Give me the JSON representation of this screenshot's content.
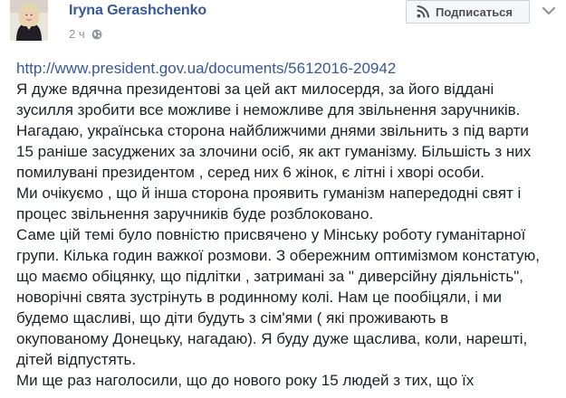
{
  "post": {
    "author": "Iryna Gerashchenko",
    "time": "2 ч",
    "privacy_icon": "globe-icon",
    "subscribe": {
      "label": "Подписаться",
      "icon": "rss-icon"
    },
    "options_icon": "chevron-down-icon",
    "link": "http://www.president.gov.ua/documents/5612016-20942",
    "lines": [
      "Я дуже вдячна президентові за цей акт милосердя, за його віддані",
      "зусилля зробити все можливе і неможливе для звільнення заручників.",
      "Нагадаю, українська сторона найближчими днями звільнить з під варти",
      "15 раніше засуджених за злочини осіб, як акт гуманізму. Більшість з них",
      "помилувані президентом , серед них 6 жінок, є літні і хворі особи.",
      "Ми очікуємо , що й інша сторона проявить гуманізм напередодні свят і",
      "процес звільнення заручників буде розблоковано.",
      "Саме цій темі було повністю присвячено у Мінську роботу гуманітарної",
      "групи. Кілька годин важкої розмови. З обережним оптимізмом констатую,",
      "що маємо обіцянку, що підлітки , затримані за \" диверсійну діяльність\",",
      "новорічні свята зустрінуть в родинному колі. Нам це пообіцяли, і ми",
      "будемо щасливі, що діти будуть з сім'ями ( які проживають в",
      "окупованому Донецьку, нагадаю). Я буду дуже щаслива, коли, нарешті,",
      "дітей відпустять.",
      "Ми ще раз наголосили, що до нового року 15 людей з тих, що їх"
    ]
  },
  "colors": {
    "link": "#365899",
    "text": "#1d2129",
    "meta": "#90949c",
    "button_bg": "#f6f7f9",
    "button_border": "#ced0d4"
  }
}
